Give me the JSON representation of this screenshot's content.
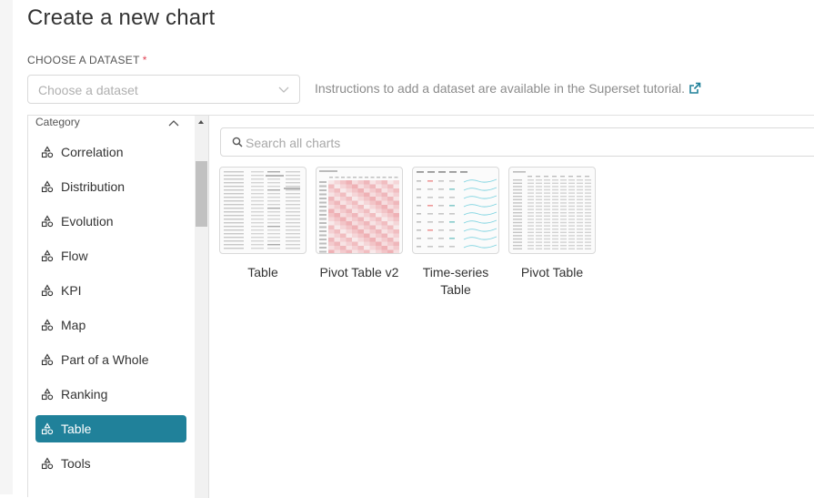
{
  "page": {
    "title": "Create a new chart"
  },
  "dataset": {
    "label": "CHOOSE A DATASET",
    "required_mark": "*",
    "placeholder": "Choose a dataset",
    "hint": "Instructions to add a dataset are available in the Superset tutorial."
  },
  "sidebar": {
    "header": "Category",
    "items": [
      {
        "label": "Correlation",
        "active": false
      },
      {
        "label": "Distribution",
        "active": false
      },
      {
        "label": "Evolution",
        "active": false
      },
      {
        "label": "Flow",
        "active": false
      },
      {
        "label": "KPI",
        "active": false
      },
      {
        "label": "Map",
        "active": false
      },
      {
        "label": "Part of a Whole",
        "active": false
      },
      {
        "label": "Ranking",
        "active": false
      },
      {
        "label": "Table",
        "active": true
      },
      {
        "label": "Tools",
        "active": false
      }
    ]
  },
  "search": {
    "placeholder": "Search all charts"
  },
  "charts": [
    {
      "name": "Table",
      "thumb": "table"
    },
    {
      "name": "Pivot Table v2",
      "thumb": "pivot-heat"
    },
    {
      "name": "Time-series Table",
      "thumb": "timeseries"
    },
    {
      "name": "Pivot Table",
      "thumb": "pivot"
    }
  ],
  "colors": {
    "accent": "#20819a",
    "required": "#e04355",
    "heat": "#e8888f",
    "sparkline": "#7dd3e0"
  }
}
